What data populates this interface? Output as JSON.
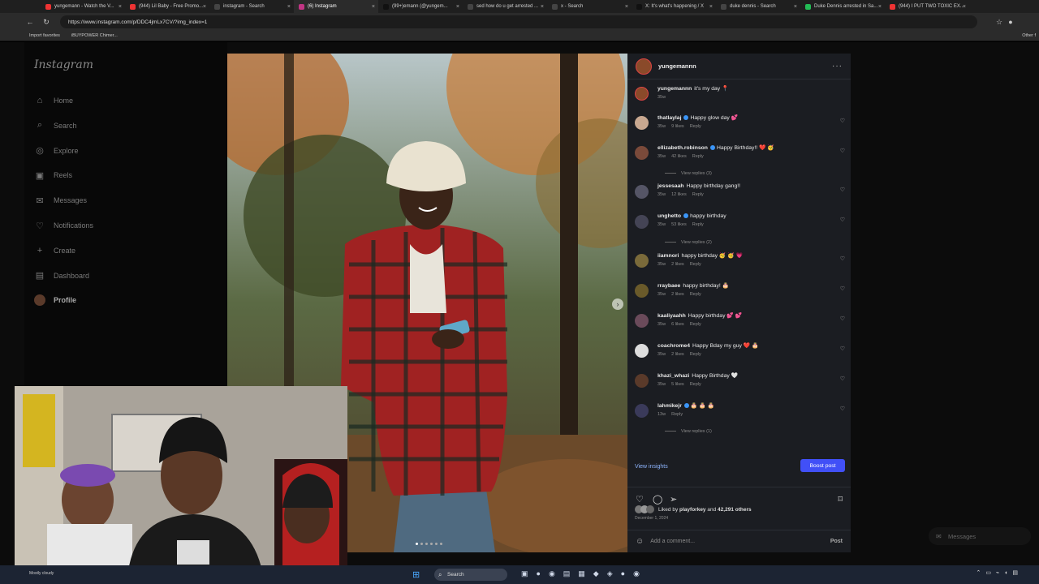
{
  "browser": {
    "tabs": [
      {
        "title": "yungemann - Watch the V...",
        "color": "#e33"
      },
      {
        "title": "(944) Lil Baby - Free Promo...",
        "color": "#e33"
      },
      {
        "title": "instagram - Search",
        "color": "#444"
      },
      {
        "title": "(6) Instagram",
        "color": "#c13584",
        "active": true
      },
      {
        "title": "(99+)emann (@yungem...",
        "color": "#111"
      },
      {
        "title": "sed how do u get arrested ...",
        "color": "#444"
      },
      {
        "title": "x - Search",
        "color": "#444"
      },
      {
        "title": "X: It's what's happening / X",
        "color": "#111"
      },
      {
        "title": "duke dennis - Search",
        "color": "#444"
      },
      {
        "title": "Duke Dennis arrested in Sa...",
        "color": "#2b5"
      },
      {
        "title": "(944) I PUT TWO TOXIC EX...",
        "color": "#e33"
      }
    ],
    "url": "https://www.instagram.com/p/DDC4jmLx7CV/?img_index=1",
    "bookmarks": [
      "Import favorites",
      "iBUYPOWER Chimer...",
      "Other f"
    ]
  },
  "sidebar": {
    "logo": "Instagram",
    "items": [
      {
        "label": "Home",
        "icon": "⌂"
      },
      {
        "label": "Search",
        "icon": "⌕"
      },
      {
        "label": "Explore",
        "icon": "◎"
      },
      {
        "label": "Reels",
        "icon": "▣"
      },
      {
        "label": "Messages",
        "icon": "✉"
      },
      {
        "label": "Notifications",
        "icon": "♡"
      },
      {
        "label": "Create",
        "icon": "+"
      },
      {
        "label": "Dashboard",
        "icon": "▤"
      },
      {
        "label": "Profile",
        "icon": ""
      }
    ]
  },
  "post": {
    "author": "yungemannn",
    "more": "···",
    "caption": {
      "user": "yungemannn",
      "text": "it's my day 📍",
      "time": "35w"
    },
    "comments": [
      {
        "user": "thatlaylaj",
        "verified": true,
        "text": "Happy glow day 💕",
        "time": "35w",
        "likes": "9 likes",
        "reply": "Reply",
        "color": "#c8a890"
      },
      {
        "user": "ellizabeth.robinson",
        "verified": true,
        "text": "Happy Birthday!! ❤️ 🥳",
        "time": "35w",
        "likes": "42 likes",
        "reply": "Reply",
        "color": "#7a4a3a",
        "replies": "View replies (3)"
      },
      {
        "user": "jessesaah",
        "verified": false,
        "text": "Happy birthday gang!!",
        "time": "35w",
        "likes": "12 likes",
        "reply": "Reply",
        "color": "#556"
      },
      {
        "user": "unghetto",
        "verified": true,
        "text": "happy birthday",
        "time": "35w",
        "likes": "53 likes",
        "reply": "Reply",
        "color": "#445",
        "replies": "View replies (2)"
      },
      {
        "user": "iiamnori",
        "verified": false,
        "text": "happy birthday 🥳 🥳 💗",
        "time": "35w",
        "likes": "2 likes",
        "reply": "Reply",
        "color": "#7a6a3a"
      },
      {
        "user": "rraybaee",
        "verified": false,
        "text": "happy birthday! 🎂",
        "time": "35w",
        "likes": "2 likes",
        "reply": "Reply",
        "color": "#6a5a2a"
      },
      {
        "user": "kaaliyaahh",
        "verified": false,
        "text": "Happy birthday 💕 💕",
        "time": "35w",
        "likes": "6 likes",
        "reply": "Reply",
        "color": "#6a4a5a"
      },
      {
        "user": "coachrome4",
        "verified": false,
        "text": "Happy Bday my guy ❤️ 🎂",
        "time": "35w",
        "likes": "2 likes",
        "reply": "Reply",
        "color": "#ddd"
      },
      {
        "user": "khazi_whazi",
        "verified": false,
        "text": "Happy Birthday 🤍",
        "time": "35w",
        "likes": "5 likes",
        "reply": "Reply",
        "color": "#5a3a2a"
      },
      {
        "user": "lahmikejr",
        "verified": true,
        "text": "🎂 🎂 🎂",
        "time": "13w",
        "likes": "",
        "reply": "Reply",
        "color": "#3a3a5a",
        "replies": "View replies (1)"
      }
    ],
    "view_insights": "View insights",
    "boost_post": "Boost post",
    "liked_by_prefix": "Liked by",
    "liked_by_user": "playforkey",
    "liked_by_rest": "and",
    "others": "42,291 others",
    "date": "December 1, 2024",
    "add_comment_placeholder": "Add a comment...",
    "post_label": "Post"
  },
  "floating": {
    "messages": "Messages"
  },
  "taskbar": {
    "search": "Search",
    "weather": "Mostly cloudy"
  }
}
